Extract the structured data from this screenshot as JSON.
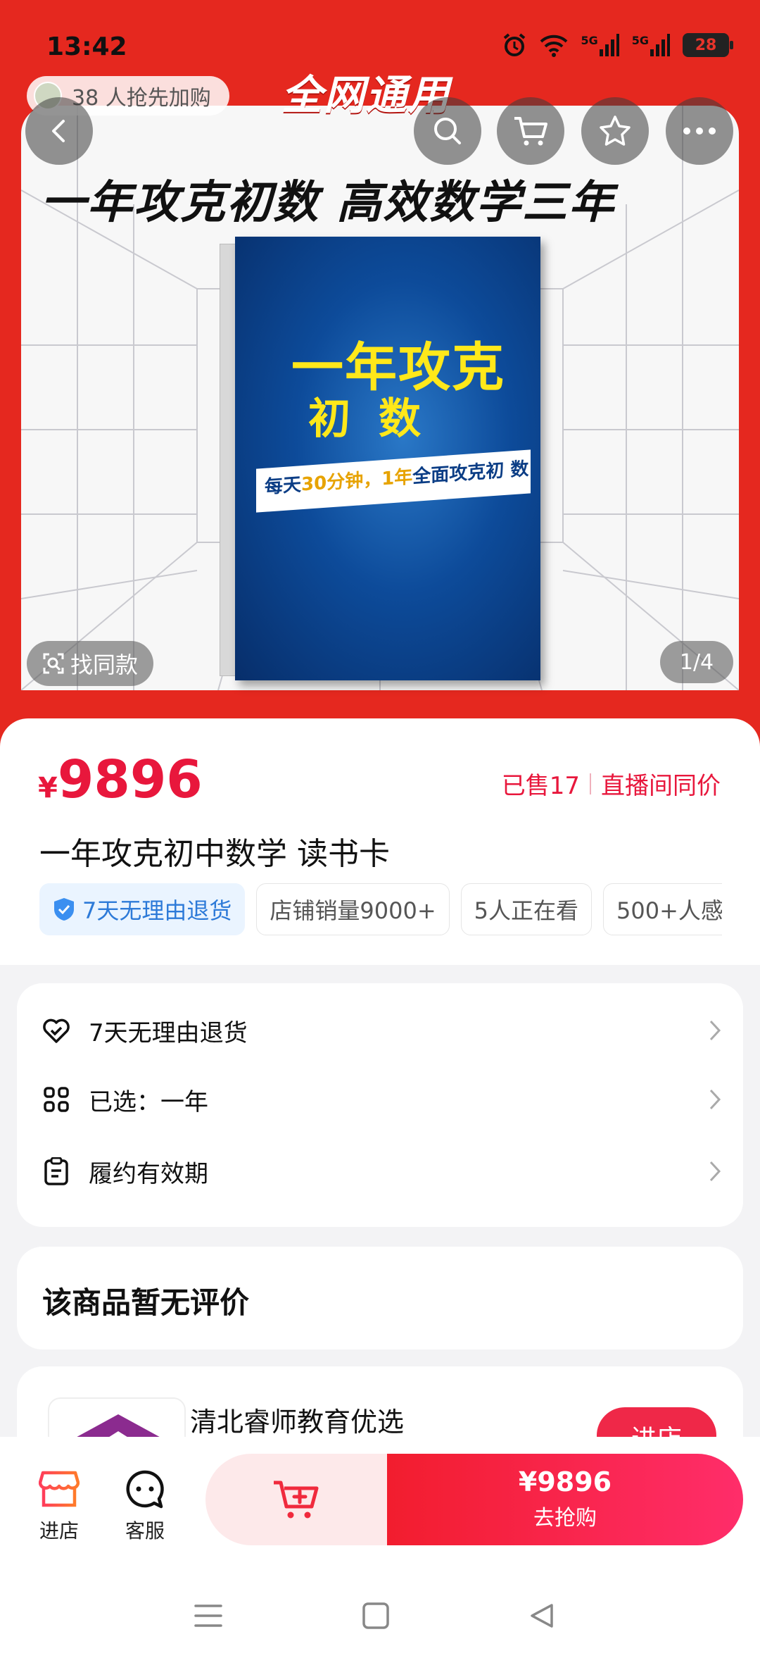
{
  "status": {
    "time": "13:42",
    "signal1": "5G",
    "signal2": "5G",
    "battery": "28"
  },
  "hero": {
    "buyers_pill": "38 人抢先加购",
    "banner": "全网通用",
    "headline": "一年攻克初数  高效数学三年",
    "book_title_line1": "一年攻克",
    "book_title_line2": "初数",
    "book_tag_prefix": "每天",
    "book_tag_highlight": "30分钟，1年",
    "book_tag_suffix": "全面攻克初 数",
    "find_same": "找同款",
    "page_indicator": "1/4"
  },
  "product": {
    "currency": "¥",
    "price": "9896",
    "sold": "已售17",
    "live_price": "直播间同价",
    "title": "一年攻克初中数学 读书卡",
    "chips": [
      "7天无理由退货",
      "店铺销量9000+",
      "5人正在看",
      "500+人感"
    ]
  },
  "info_rows": [
    {
      "label": "7天无理由退货",
      "icon": "heart-shield-icon"
    },
    {
      "label": "已选：一年",
      "icon": "grid-icon"
    },
    {
      "label": "履约有效期",
      "icon": "clipboard-icon"
    }
  ],
  "reviews": {
    "text": "该商品暂无评价"
  },
  "shop": {
    "name": "清北睿师教育优选",
    "enter": "进店"
  },
  "bottom": {
    "store": "进店",
    "service": "客服",
    "buy_price": "¥9896",
    "buy_label": "去抢购"
  },
  "colors": {
    "brand_red": "#e5281f",
    "price_red": "#e8173c",
    "chip_blue": "#2d7ad8"
  }
}
